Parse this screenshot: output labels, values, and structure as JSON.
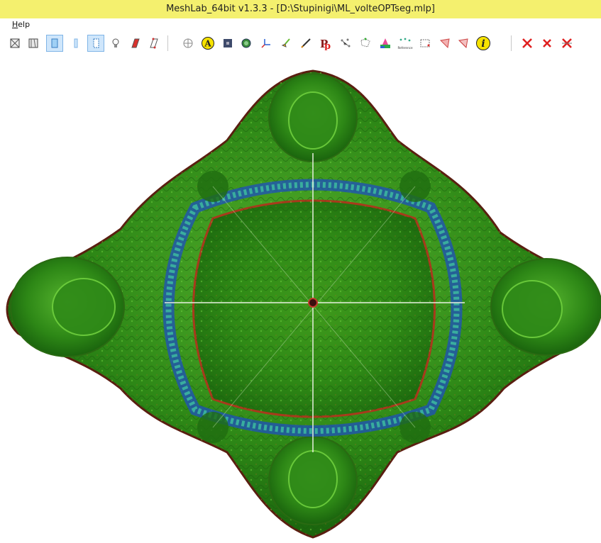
{
  "window": {
    "title": "MeshLab_64bit v1.3.3 - [D:\\Stupinigi\\ML_volteOPTseg.mlp]"
  },
  "menu": {
    "items": [
      {
        "label": "Help"
      }
    ]
  },
  "toolbar": {
    "info_glyph": "i",
    "reference_caption": "Reference",
    "buttons": [
      "open-project-icon",
      "save-project-icon",
      "bounding-box-view-icon",
      "points-view-icon",
      "wireframe-view-icon",
      "light-bulb-icon",
      "flat-shading-icon",
      "vertex-shading-icon",
      "trackball-icon",
      "annotation-a-icon",
      "texture-icon",
      "mesh-layers-icon",
      "axis-icon",
      "paint-brush-icon",
      "pencil-icon",
      "pick-points-icon",
      "align-icon",
      "manipulator-icon",
      "color-paint-icon",
      "reference-icon",
      "select-vertices-icon",
      "select-faces-icon",
      "select-connected-icon",
      "info-icon",
      "delete-vertices-icon",
      "delete-faces-icon",
      "delete-faces-vertices-icon"
    ]
  },
  "colors": {
    "titlebar": "#f4f06e",
    "mesh_green": "#2a8a12",
    "mesh_highlight": "#3fc02a",
    "band_blue": "#1d4fbf",
    "selection": "#cfe6fb"
  }
}
